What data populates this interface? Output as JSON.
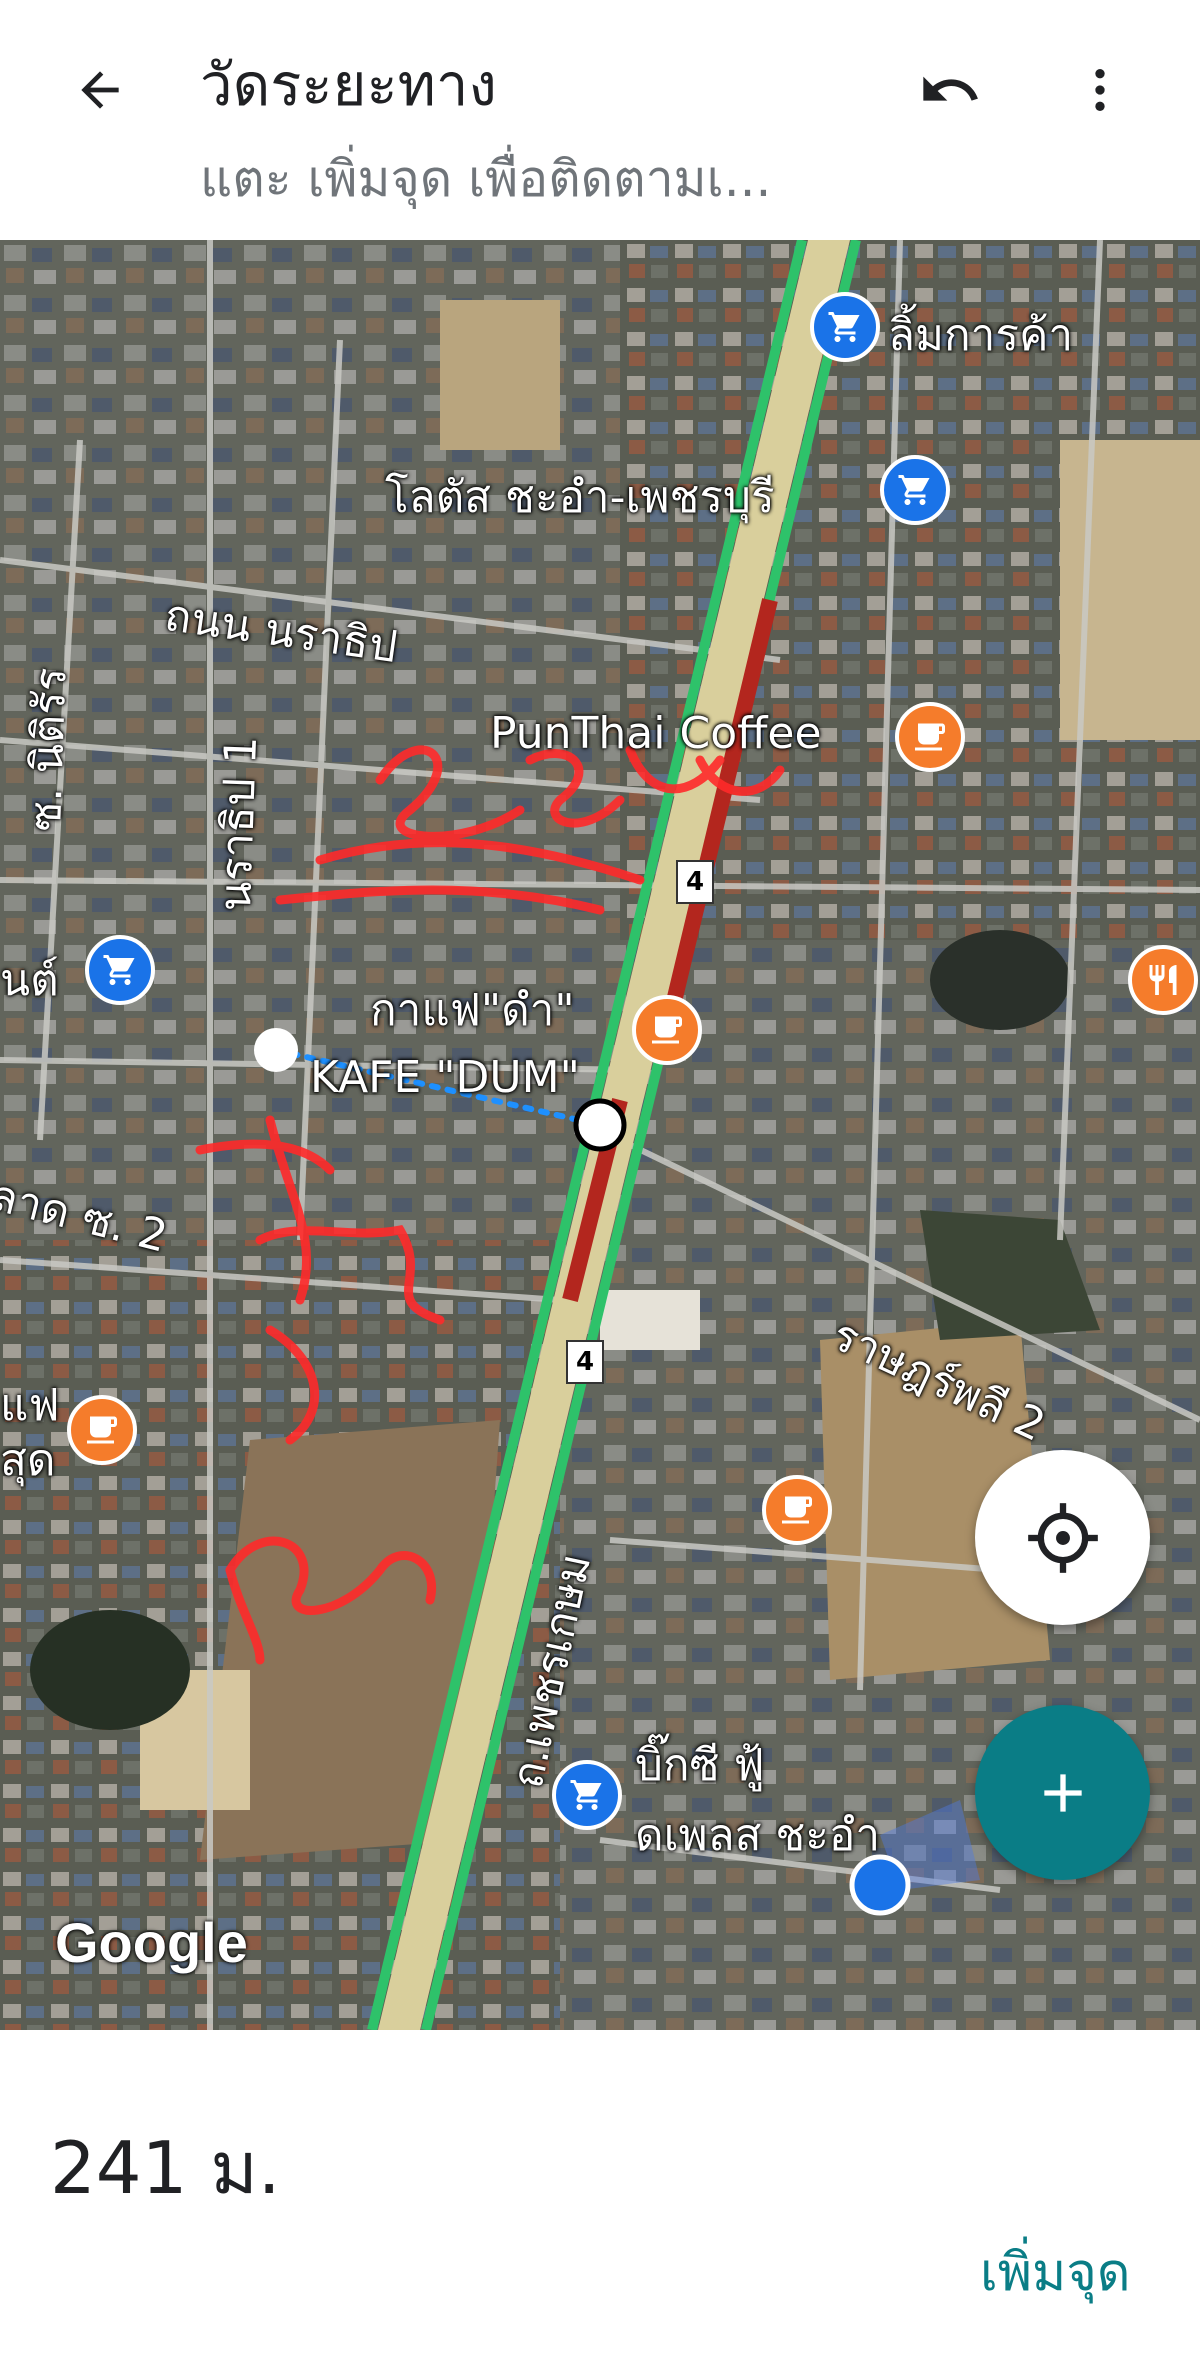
{
  "header": {
    "title": "วัดระยะทาง",
    "subtitle": "แตะ เพิ่มจุด เพื่อติดตามเ..."
  },
  "map": {
    "labels": {
      "limkarnka": "ลิ้มการค้า",
      "lotus": "โลตัส ชะอำ-เพชรบุรี",
      "narathip_road": "ถนน นราธิป",
      "punthai": "PunThai Coffee",
      "nitirat": "ซ. นิติรัร",
      "narathip1": "นราธิป 1",
      "cafe_dam": "กาแฟ\"ดำ\"",
      "kafe_dum": "KAFE \"DUM\"",
      "talad_soi2": "ลาด ซ. 2",
      "left_shop": "นต์",
      "left_cafe_1": "แฟ",
      "left_cafe_2": "สุด",
      "ratsadonphli2": "ราษฎร์พลี 2",
      "phetkasem": "ถ.เพชรเกษม",
      "bigc_1": "บิ๊กซี ฟู้",
      "bigc_2": "ดเพลส ชะอำ",
      "route_number": "4"
    },
    "google_logo": "Google",
    "colors": {
      "traffic_green": "#2ec26a",
      "traffic_red": "#b3261e",
      "shop_pin": "#1a73e8",
      "cafe_pin": "#f57c2b",
      "measure_line": "#1e90ff",
      "annotation": "#ff2a2a"
    }
  },
  "buttons": {
    "my_location_icon": "crosshair-icon",
    "add_fab_icon": "plus-icon"
  },
  "bottom": {
    "distance": "241 ม.",
    "add_point": "เพิ่มจุด"
  }
}
